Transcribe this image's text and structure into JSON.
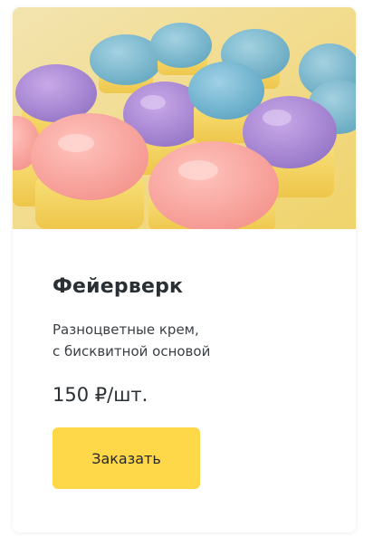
{
  "product": {
    "image_alt": "cupcakes-with-pastel-cream",
    "title": "Фейерверк",
    "description_lines": [
      "Разноцветные крем,",
      "с бисквитной основой"
    ],
    "price": "150 ₽/шт.",
    "order_label": "Заказать"
  },
  "colors": {
    "button_bg": "#ffd84a",
    "title": "#2a2f33",
    "text": "#3a3f44"
  }
}
